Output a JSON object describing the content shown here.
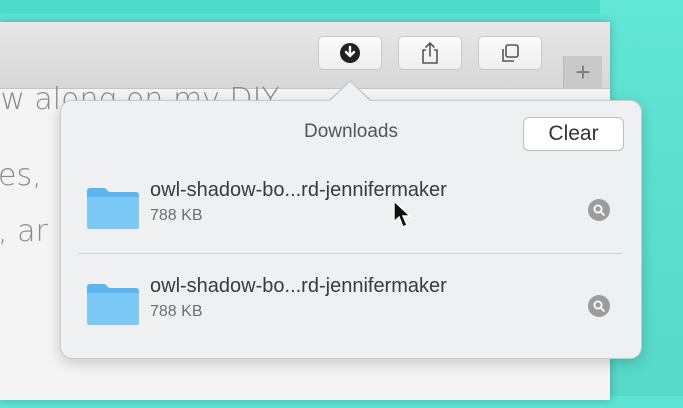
{
  "toolbar": {
    "download_icon": "download-arrow-icon",
    "share_icon": "share-icon",
    "tabs_icon": "tab-overview-icon",
    "new_tab_label": "+"
  },
  "page": {
    "line1": "ow along on my DIY",
    "line2": "es,",
    "line3": ", ar"
  },
  "downloads": {
    "title": "Downloads",
    "clear_label": "Clear",
    "items": [
      {
        "name": "owl-shadow-bo...rd-jennifermaker",
        "size": "788 KB",
        "icon": "folder-icon",
        "action_icon": "magnifier-icon"
      },
      {
        "name": "owl-shadow-bo...rd-jennifermaker",
        "size": "788 KB",
        "icon": "folder-icon",
        "action_icon": "magnifier-icon"
      }
    ]
  },
  "colors": {
    "background_teal": "#5fe3d4",
    "folder_blue": "#6ec3f4",
    "popover_bg": "#eef0f2"
  }
}
